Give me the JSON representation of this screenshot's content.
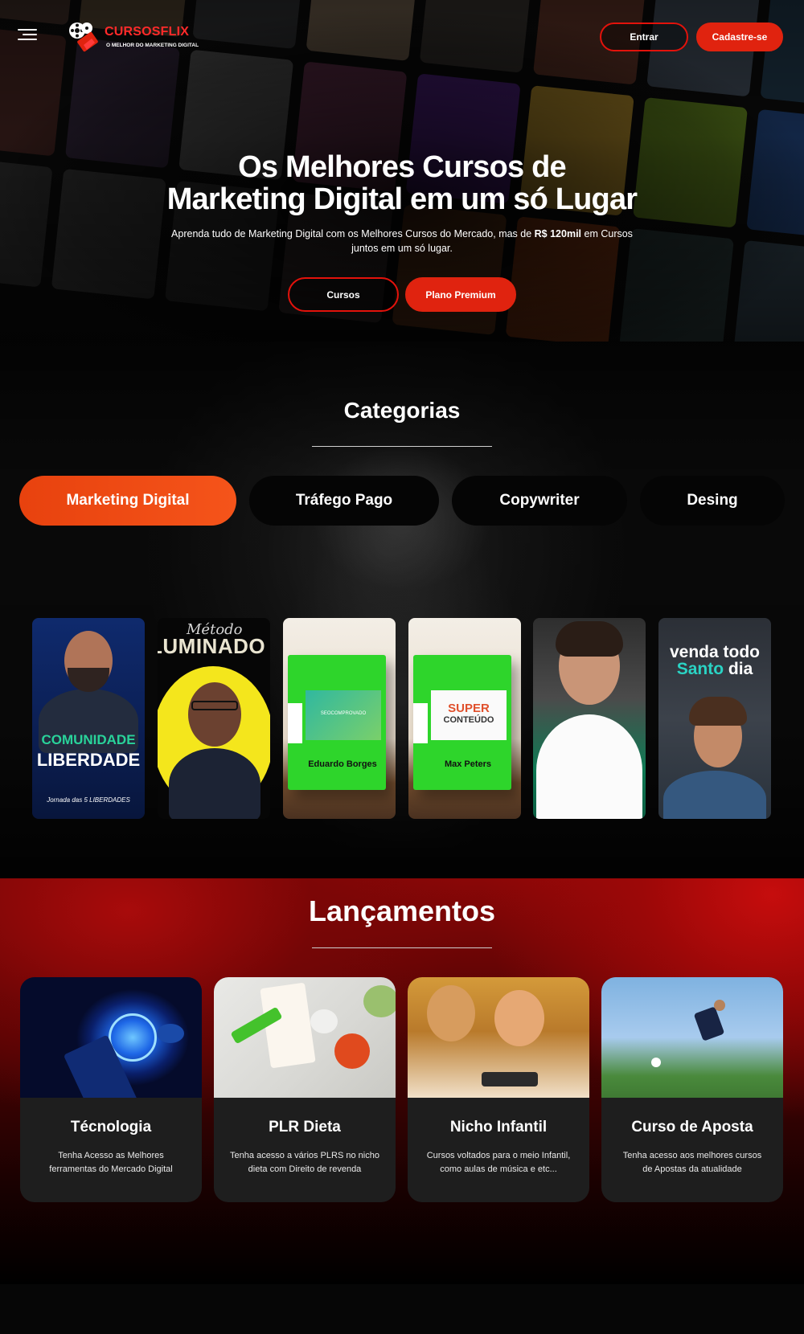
{
  "header": {
    "logo": {
      "name": "CURSOSFLIX",
      "tagline": "O MELHOR DO MARKETING DIGITAL"
    },
    "menu_icon": "hamburger-menu-icon",
    "login_label": "Entrar",
    "signup_label": "Cadastre-se"
  },
  "hero": {
    "title_line1": "Os Melhores Cursos de",
    "title_line2": "Marketing Digital em um só Lugar",
    "subtitle_start": "Aprenda tudo de Marketing Digital com os Melhores Cursos do Mercado, mas de ",
    "subtitle_bold": "R$ 120mil",
    "subtitle_end": " em Cursos juntos em um só lugar.",
    "cursos_label": "Cursos",
    "premium_label": "Plano Premium"
  },
  "categories": {
    "title": "Categorias",
    "tabs": [
      {
        "label": "Marketing Digital",
        "active": true
      },
      {
        "label": "Tráfego Pago",
        "active": false
      },
      {
        "label": "Copywriter",
        "active": false
      },
      {
        "label": "Desing",
        "active": false
      }
    ],
    "courses": [
      {
        "line1": "COMUNIDADE",
        "line2": "LIBERDADE",
        "line3": "Jornada das 5 LIBERDADES"
      },
      {
        "line1": "Método",
        "line2": "LUMINADO"
      },
      {
        "label": "SEOCOMPROVADO",
        "author": "Eduardo Borges"
      },
      {
        "label_top": "SUPER",
        "label_bottom": "CONTEÚDO",
        "author": "Max Peters"
      },
      {
        "line1": ""
      },
      {
        "line1": "venda todo",
        "line2_accent": "Santo",
        "line2_rest": " dia"
      }
    ]
  },
  "launches": {
    "title": "Lançamentos",
    "cards": [
      {
        "title": "Técnologia",
        "description": "Tenha Acesso as Melhores ferramentas do Mercado Digital"
      },
      {
        "title": "PLR Dieta",
        "description": "Tenha acesso a vários PLRS no nicho dieta com Direito de revenda"
      },
      {
        "title": "Nicho Infantil",
        "description": "Cursos voltados para o meio Infantil, como aulas de música e etc..."
      },
      {
        "title": "Curso de Aposta",
        "description": "Tenha acesso aos melhores cursos de Apostas da atualidade"
      }
    ]
  },
  "colors": {
    "brand_red": "#e0230f",
    "active_tab": "#f04a14",
    "background": "#000000"
  }
}
